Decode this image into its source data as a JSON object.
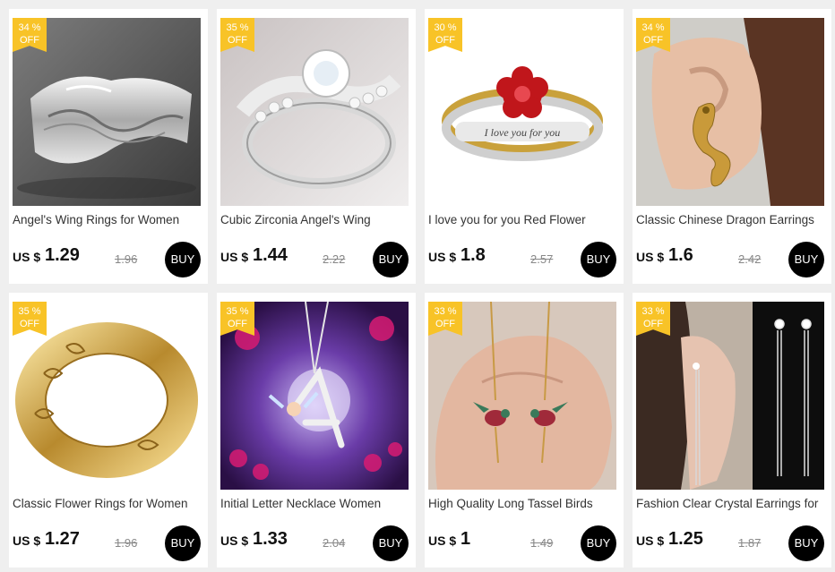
{
  "products": [
    {
      "discount_pct": "34 %",
      "discount_off": "OFF",
      "title": "Angel's Wing Rings for Women",
      "currency": "US $",
      "price": "1.29",
      "original_price": "1.96",
      "buy_label": "BUY",
      "image": "silver angel wing ring"
    },
    {
      "discount_pct": "35 %",
      "discount_off": "OFF",
      "title": "Cubic Zirconia Angel's Wing",
      "currency": "US $",
      "price": "1.44",
      "original_price": "2.22",
      "buy_label": "BUY",
      "image": "crystal angel wing ring"
    },
    {
      "discount_pct": "30 %",
      "discount_off": "OFF",
      "title": "I love you for you Red Flower",
      "currency": "US $",
      "price": "1.8",
      "original_price": "2.57",
      "buy_label": "BUY",
      "image": "red flower ring engraved",
      "engraving": "I love you for you"
    },
    {
      "discount_pct": "34 %",
      "discount_off": "OFF",
      "title": "Classic Chinese Dragon Earrings",
      "currency": "US $",
      "price": "1.6",
      "original_price": "2.42",
      "buy_label": "BUY",
      "image": "gold dragon earring on ear"
    },
    {
      "discount_pct": "35 %",
      "discount_off": "OFF",
      "title": "Classic Flower Rings for Women",
      "currency": "US $",
      "price": "1.27",
      "original_price": "1.96",
      "buy_label": "BUY",
      "image": "gold engraved flower ring"
    },
    {
      "discount_pct": "35 %",
      "discount_off": "OFF",
      "title": "Initial Letter Necklace Women",
      "currency": "US $",
      "price": "1.33",
      "original_price": "2.04",
      "buy_label": "BUY",
      "image": "fairy letter necklace purple forest"
    },
    {
      "discount_pct": "33 %",
      "discount_off": "OFF",
      "title": "High Quality Long Tassel Birds",
      "currency": "US $",
      "price": "1",
      "original_price": "1.49",
      "buy_label": "BUY",
      "image": "hummingbird earrings on palm"
    },
    {
      "discount_pct": "33 %",
      "discount_off": "OFF",
      "title": "Fashion Clear Crystal Earrings for",
      "currency": "US $",
      "price": "1.25",
      "original_price": "1.87",
      "buy_label": "BUY",
      "image": "long silver tassel earrings"
    }
  ],
  "colors": {
    "badge": "#f8c327",
    "buy_button": "#000000",
    "background": "#efefef",
    "card": "#ffffff"
  }
}
